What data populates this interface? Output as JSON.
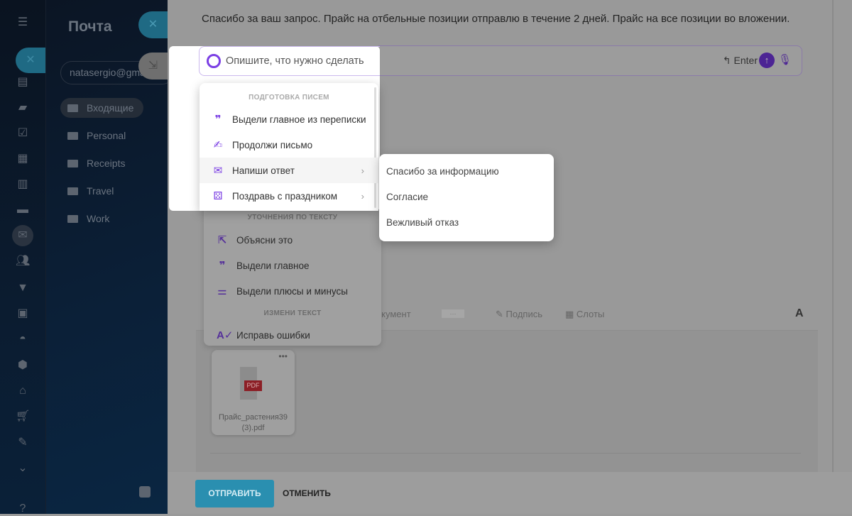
{
  "app": {
    "title": "Почта",
    "account": "natasergio@gmail.com"
  },
  "folders": [
    {
      "label": "Входящие",
      "icon": "mail-icon",
      "active": true
    },
    {
      "label": "Personal",
      "icon": "folder-icon"
    },
    {
      "label": "Receipts",
      "icon": "folder-icon"
    },
    {
      "label": "Travel",
      "icon": "folder-icon"
    },
    {
      "label": "Work",
      "icon": "folder-icon"
    }
  ],
  "rail_icons": [
    "menu-icon",
    "close-icon",
    "browser-icon",
    "chat-icon",
    "tasks-icon",
    "calendar-icon",
    "document-icon",
    "drive-icon",
    "mail-icon",
    "contacts-icon",
    "filter-icon",
    "id-card-icon",
    "robot-icon",
    "box-icon",
    "warehouse-icon",
    "cart-icon",
    "signature-icon",
    "more-icon",
    "help-icon"
  ],
  "email": {
    "body": "Спасибо за ваш запрос. Прайс на отбельные позиции отправлю в течение 2 дней. Прайс на все позиции во вложении."
  },
  "ai_input": {
    "placeholder": "Опишите, что нужно сделать",
    "enter_hint": "Enter"
  },
  "ai_menu": {
    "section1": "ПОДГОТОВКА ПИСЕМ",
    "items1": [
      {
        "label": "Выдели главное из переписки",
        "icon": "quote-icon"
      },
      {
        "label": "Продолжи письмо",
        "icon": "signature-icon"
      },
      {
        "label": "Напиши ответ",
        "icon": "mail-reply-icon",
        "submenu": true
      },
      {
        "label": "Поздравь с праздником",
        "icon": "gift-icon",
        "submenu": true
      }
    ],
    "section2": "УТОЧНЕНИЯ ПО ТЕКСТУ",
    "items2": [
      {
        "label": "Объясни это",
        "icon": "cursor-click-icon"
      },
      {
        "label": "Выдели главное",
        "icon": "quote-icon"
      },
      {
        "label": "Выдели плюсы и минусы",
        "icon": "sliders-icon"
      }
    ],
    "section3": "ИЗМЕНИ ТЕКСТ",
    "items3": [
      {
        "label": "Исправь ошибки",
        "icon": "spellcheck-icon"
      }
    ]
  },
  "submenu": [
    "Спасибо за информацию",
    "Согласие",
    "Вежливый отказ"
  ],
  "toolbar": {
    "document": "Документ",
    "more": "···",
    "signature": "Подпись",
    "slots": "Слоты",
    "font": "A"
  },
  "attachment": {
    "name": "Прайс_растения39 (3).pdf",
    "badge": "PDF"
  },
  "footer": {
    "send": "ОТПРАВИТЬ",
    "cancel": "ОТМЕНИТЬ"
  },
  "colors": {
    "accent": "#7b3fe4",
    "send": "#2a8fb0"
  }
}
